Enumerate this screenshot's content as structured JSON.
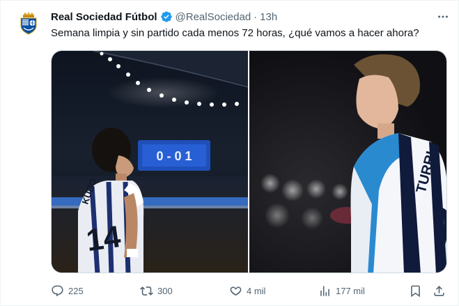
{
  "tweet": {
    "author_name": "Real Sociedad Fútbol",
    "handle": "@RealSociedad",
    "separator": "·",
    "time": "13h",
    "text": "Semana limpia y sin partido cada menos 72 horas, ¿qué vamos a hacer ahora?",
    "verified_color": "#1d9bf0",
    "images": [
      {
        "jersey_number": "14",
        "jersey_name": "KUBO"
      },
      {
        "jersey_name": "TURRI"
      }
    ],
    "scoreboard_text": "0 - 0 1"
  },
  "actions": {
    "replies": "225",
    "retweets": "300",
    "likes": "4 mil",
    "views": "177 mil"
  },
  "icons": [
    "club-crest-icon",
    "verified-badge-icon",
    "more-icon",
    "reply-icon",
    "retweet-icon",
    "like-icon",
    "views-icon",
    "bookmark-icon",
    "share-icon"
  ]
}
